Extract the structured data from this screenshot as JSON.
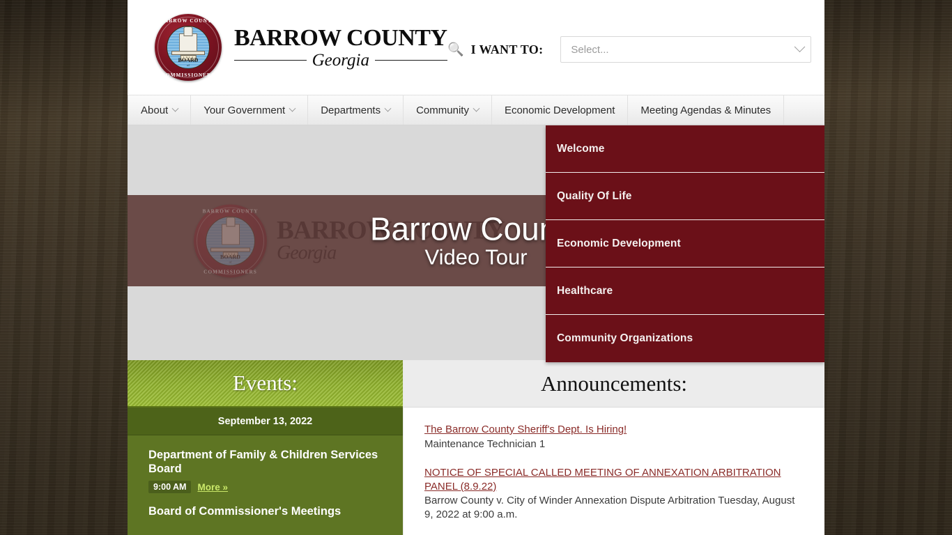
{
  "header": {
    "logo": {
      "seal_top_text": "BARROW COUNTY",
      "seal_bottom_text": "COMMISSIONERS",
      "seal_plaque": "1 9 1 4",
      "seal_board": "BOARD",
      "seal_board_of": "of",
      "wordmark_line1": "BARROW COUNTY",
      "wordmark_line2": "Georgia"
    },
    "search": {
      "icon": "search-icon",
      "label": "I WANT TO:",
      "select_value": "Select...",
      "chevron": "chevron-down-icon"
    }
  },
  "nav": {
    "items": [
      {
        "label": "About",
        "has_caret": true
      },
      {
        "label": "Your Government",
        "has_caret": true
      },
      {
        "label": "Departments",
        "has_caret": true
      },
      {
        "label": "Community",
        "has_caret": true
      },
      {
        "label": "Economic Development",
        "has_caret": false
      },
      {
        "label": "Meeting Agendas & Minutes",
        "has_caret": false
      }
    ]
  },
  "dropdown": {
    "parent": "Community",
    "accent_color": "#6b1018",
    "items": [
      {
        "label": "Welcome"
      },
      {
        "label": "Quality Of Life"
      },
      {
        "label": "Economic Development"
      },
      {
        "label": "Healthcare"
      },
      {
        "label": "Community Organizations"
      }
    ]
  },
  "banner": {
    "title": "Barrow County",
    "subtitle": "Video Tour",
    "watermark_line1": "BARROW COUNTY",
    "watermark_line2": "Georgia",
    "overlay_color": "#6b4b48"
  },
  "events": {
    "heading": "Events:",
    "date": "September 13, 2022",
    "accent_color": "#8aab28",
    "items": [
      {
        "title": "Department of Family & Children Services Board",
        "time": "9:00 AM",
        "more_label": "More »"
      },
      {
        "title": "Board of Commissioner's Meetings",
        "time": "",
        "more_label": ""
      }
    ]
  },
  "announcements": {
    "heading": "Announcements:",
    "link_color": "#8a2b28",
    "items": [
      {
        "link": "The Barrow County Sheriff's Dept. Is Hiring!",
        "desc": "Maintenance Technician 1"
      },
      {
        "link": "NOTICE OF SPECIAL CALLED MEETING OF ANNEXATION ARBITRATION PANEL (8.9.22)",
        "desc": "Barrow County v. City of Winder Annexation Dispute Arbitration Tuesday, August 9, 2022 at 9:00 a.m."
      }
    ]
  }
}
